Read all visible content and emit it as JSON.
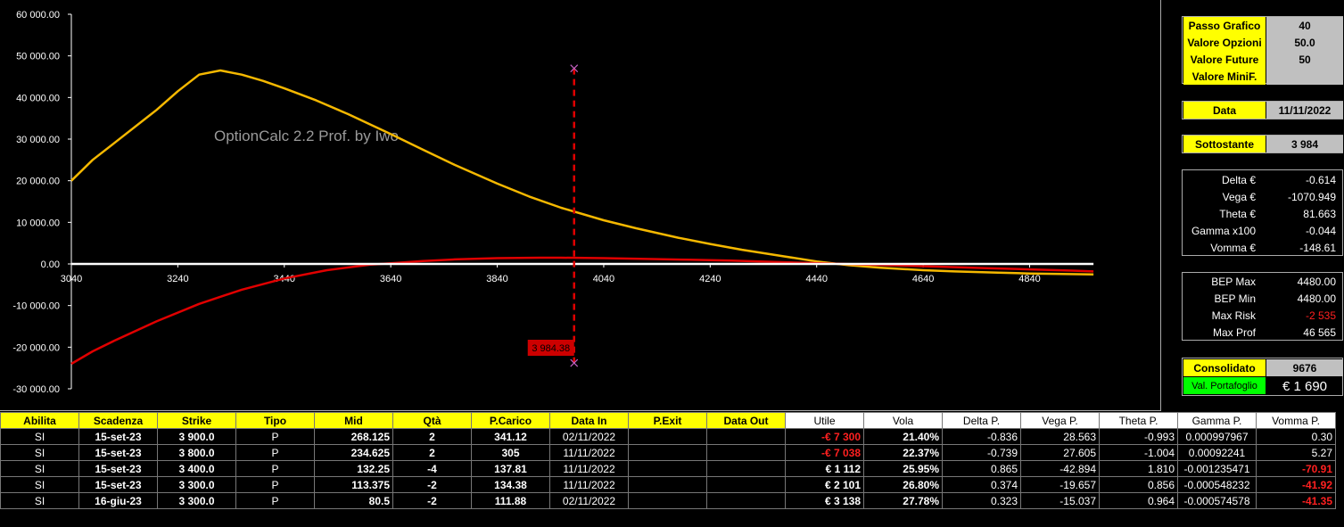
{
  "chart_data": {
    "type": "line",
    "watermark": "OptionCalc 2.2 Prof. by Iwo",
    "xlim": [
      3040,
      5000
    ],
    "ylim": [
      -30000,
      60000
    ],
    "x_ticks": [
      "3040",
      "3240",
      "3440",
      "3640",
      "3840",
      "4040",
      "4240",
      "4440",
      "4640",
      "4840"
    ],
    "y_ticks": [
      "60 000.00",
      "50 000.00",
      "40 000.00",
      "30 000.00",
      "20 000.00",
      "10 000.00",
      "0.00",
      "-10 000.00",
      "-20 000.00",
      "-30 000.00"
    ],
    "y_tick_values": [
      60000,
      50000,
      40000,
      30000,
      20000,
      10000,
      0,
      -10000,
      -20000,
      -30000
    ],
    "cursor": {
      "x": 3984.38,
      "label": "3 984.38",
      "y_top": 47000,
      "y_bottom": -23800
    },
    "series": [
      {
        "color": "#f5b800",
        "x": [
          3040,
          3080,
          3120,
          3200,
          3240,
          3280,
          3320,
          3360,
          3400,
          3440,
          3500,
          3560,
          3640,
          3700,
          3760,
          3840,
          3900,
          3960,
          4040,
          4100,
          4180,
          4240,
          4300,
          4380,
          4440,
          4500,
          4560,
          4640,
          4700,
          4780,
          4840,
          4900,
          4960
        ],
        "y": [
          20000,
          25000,
          29000,
          37000,
          41500,
          45500,
          46500,
          45500,
          44000,
          42200,
          39300,
          36000,
          31200,
          27500,
          23800,
          19300,
          16200,
          13500,
          10500,
          8600,
          6300,
          4800,
          3400,
          1800,
          600,
          -300,
          -900,
          -1500,
          -1800,
          -2100,
          -2300,
          -2400,
          -2500
        ]
      },
      {
        "color": "#e00000",
        "x": [
          3040,
          3080,
          3120,
          3200,
          3280,
          3360,
          3440,
          3520,
          3600,
          3640,
          3700,
          3760,
          3840,
          3920,
          3960,
          4040,
          4120,
          4200,
          4280,
          4360,
          4440,
          4520,
          4600,
          4680,
          4760,
          4840,
          4920,
          4960
        ],
        "y": [
          -24000,
          -21000,
          -18500,
          -13800,
          -9600,
          -6200,
          -3500,
          -1500,
          -200,
          150,
          700,
          1100,
          1400,
          1500,
          1500,
          1400,
          1200,
          1000,
          800,
          500,
          200,
          -100,
          -400,
          -700,
          -1000,
          -1300,
          -1600,
          -1800
        ]
      },
      {
        "color": "#ffffff",
        "x": [
          3040,
          4960
        ],
        "y": [
          0,
          0
        ]
      }
    ]
  },
  "panel": {
    "settings": [
      {
        "label": "Passo Grafico",
        "value": "40"
      },
      {
        "label": "Valore Opzioni",
        "value": "50.0"
      },
      {
        "label": "Valore Future",
        "value": "50"
      },
      {
        "label": "Valore MiniF.",
        "value": ""
      }
    ],
    "data_label": "Data",
    "data_value": "11/11/2022",
    "sott_label": "Sottostante",
    "sott_value": "3 984",
    "greeks": [
      {
        "label": "Delta €",
        "value": "-0.614"
      },
      {
        "label": "Vega €",
        "value": "-1070.949"
      },
      {
        "label": "Theta €",
        "value": "81.663"
      },
      {
        "label": "Gamma x100",
        "value": "-0.044"
      },
      {
        "label": "Vomma €",
        "value": "-148.61"
      }
    ],
    "bep": [
      {
        "label": "BEP Max",
        "value": "4480.00",
        "red": false
      },
      {
        "label": "BEP Min",
        "value": "4480.00",
        "red": false
      },
      {
        "label": "Max Risk",
        "value": "-2 535",
        "red": true
      },
      {
        "label": "Max Prof",
        "value": "46 565",
        "red": false
      }
    ],
    "cons_label": "Consolidato",
    "cons_value": "9676",
    "port_label": "Val. Portafoglio",
    "port_value": "€ 1 690"
  },
  "table": {
    "headers": [
      "Abilita",
      "Scadenza",
      "Strike",
      "Tipo",
      "Mid",
      "Qtà",
      "P.Carico",
      "Data In",
      "P.Exit",
      "Data Out",
      "Utile",
      "Vola",
      "Delta P.",
      "Vega P.",
      "Theta P.",
      "Gamma P.",
      "Vomma P."
    ],
    "rows": [
      [
        "SI",
        "15-set-23",
        "3 900.0",
        "P",
        "268.125",
        "2",
        "341.12",
        "02/11/2022",
        "",
        "",
        "-€ 7 300",
        "21.40%",
        "-0.836",
        "28.563",
        "-0.993",
        "0.000997967",
        "0.30"
      ],
      [
        "SI",
        "15-set-23",
        "3 800.0",
        "P",
        "234.625",
        "2",
        "305",
        "11/11/2022",
        "",
        "",
        "-€ 7 038",
        "22.37%",
        "-0.739",
        "27.605",
        "-1.004",
        "0.00092241",
        "5.27"
      ],
      [
        "SI",
        "15-set-23",
        "3 400.0",
        "P",
        "132.25",
        "-4",
        "137.81",
        "11/11/2022",
        "",
        "",
        "€ 1 112",
        "25.95%",
        "0.865",
        "-42.894",
        "1.810",
        "-0.001235471",
        "-70.91"
      ],
      [
        "SI",
        "15-set-23",
        "3 300.0",
        "P",
        "113.375",
        "-2",
        "134.38",
        "11/11/2022",
        "",
        "",
        "€ 2 101",
        "26.80%",
        "0.374",
        "-19.657",
        "0.856",
        "-0.000548232",
        "-41.92"
      ],
      [
        "SI",
        "16-giu-23",
        "3 300.0",
        "P",
        "80.5",
        "-2",
        "111.88",
        "02/11/2022",
        "",
        "",
        "€ 3 138",
        "27.78%",
        "0.323",
        "-15.037",
        "0.964",
        "-0.000574578",
        "-41.35"
      ]
    ]
  }
}
